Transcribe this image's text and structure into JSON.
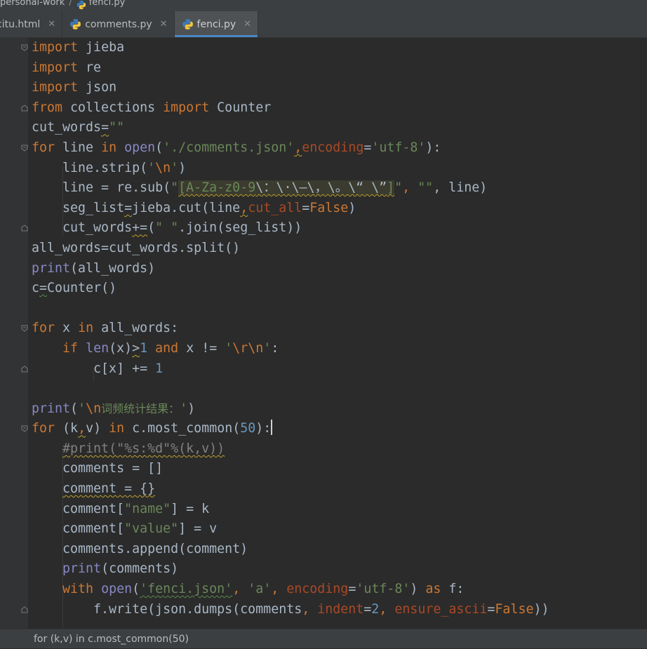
{
  "breadcrumb": {
    "project": "personal-work",
    "separator": "/",
    "file": "fenci.py"
  },
  "tabs": [
    {
      "label": "citu.html",
      "active": false
    },
    {
      "label": "comments.py",
      "active": false
    },
    {
      "label": "fenci.py",
      "active": true
    }
  ],
  "tab_close_symbol": "✕",
  "colors": {
    "background": "#2b2b2b",
    "keyword": "#cc7832",
    "builtin": "#8888c6",
    "string": "#6a8759",
    "number": "#6897bb",
    "parameter": "#aa4926",
    "comment": "#808080",
    "text": "#a9b7c6",
    "tab_active_underline": "#4a88c7"
  },
  "code": {
    "l1": [
      "import",
      " jieba"
    ],
    "l2": [
      "import",
      " re"
    ],
    "l3": [
      "import",
      " json"
    ],
    "l4": [
      "from",
      " collections ",
      "import",
      " Counter"
    ],
    "l5": [
      "cut_words",
      "=",
      "\"\""
    ],
    "l6": [
      "for",
      " line ",
      "in",
      " ",
      "open",
      "(",
      "'./comments.json'",
      ",",
      "encoding",
      "=",
      "'utf-8'",
      "):"
    ],
    "l7": [
      "    line.strip(",
      "'",
      "\\n",
      "'",
      ")"
    ],
    "l8": [
      "    line = re.sub(",
      "\"",
      "[A-Za-z0-9",
      "\\：\\·\\—\\，\\。\\“ \\”",
      "]",
      "\"",
      ", ",
      "\"\"",
      ", line)"
    ],
    "l9": [
      "    seg_list",
      "=",
      "jieba.cut(line",
      ",",
      "cut_all",
      "=",
      "False",
      ")"
    ],
    "l10": [
      "    cut_words",
      "+=",
      "(",
      "\" \"",
      ".join(seg_list))"
    ],
    "l11": [
      "all_words=cut_words.split()"
    ],
    "l12": [
      "print",
      "(all_words)"
    ],
    "l13": [
      "c",
      "=",
      "Counter()"
    ],
    "l14": [
      ""
    ],
    "l15": [
      "for",
      " x ",
      "in",
      " all_words:"
    ],
    "l16": [
      "    ",
      "if",
      " ",
      "len",
      "(x)",
      ">",
      "1",
      " ",
      "and",
      " x != ",
      "'",
      "\\r\\n",
      "'",
      ":"
    ],
    "l17": [
      "        c[x] += ",
      "1"
    ],
    "l18": [
      ""
    ],
    "l19": [
      "print",
      "(",
      "'",
      "\\n",
      "词频统计结果：",
      "'",
      ")"
    ],
    "l20": [
      "for",
      " (k",
      ",",
      "v) ",
      "in",
      " c.most_common(",
      "50",
      "):"
    ],
    "l21": [
      "    ",
      "#print(\"%s:%d\"%(k,v))"
    ],
    "l22": [
      "    comments = []"
    ],
    "l23": [
      "    ",
      "comment = {}"
    ],
    "l24": [
      "    comment[",
      "\"name\"",
      "] = k"
    ],
    "l25": [
      "    comment[",
      "\"value\"",
      "] = v"
    ],
    "l26": [
      "    comments.append(comment)"
    ],
    "l27": [
      "    ",
      "print",
      "(comments)"
    ],
    "l28": [
      "    ",
      "with",
      " ",
      "open",
      "(",
      "'fenci.json'",
      ", ",
      "'a'",
      ", ",
      "encoding",
      "=",
      "'utf-8'",
      ") ",
      "as",
      " f:"
    ],
    "l29": [
      "        f.write(json.dumps(comments",
      ", ",
      "indent",
      "=",
      "2",
      ", ",
      "ensure_ascii",
      "=",
      "False",
      "))"
    ]
  },
  "status": {
    "context": "for (k,v) in c.most_common(50)"
  }
}
